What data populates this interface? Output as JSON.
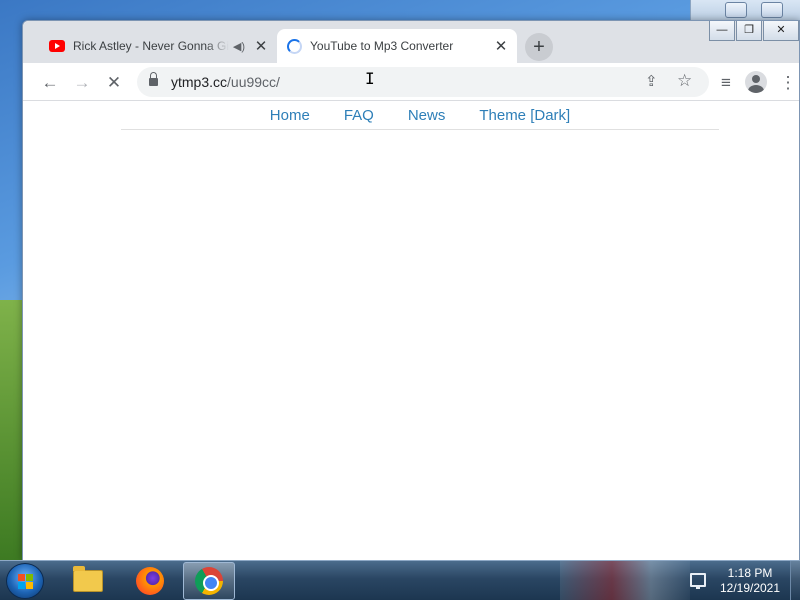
{
  "browser": {
    "tabs": [
      {
        "title": "Rick Astley - Never Gonna Give You Up",
        "favicon": "youtube-icon",
        "audio": "audio-playing-icon",
        "active": false
      },
      {
        "title": "YouTube to Mp3 Converter",
        "favicon": "loading-spinner-icon",
        "active": true
      }
    ],
    "toolbar": {
      "back": "←",
      "forward": "→",
      "stop": "✕",
      "url_host": "ytmp3.cc",
      "url_path": "/uu99cc/",
      "share": "⇪",
      "star": "☆",
      "media": "≡"
    },
    "window_controls": {
      "minimize": "—",
      "maximize": "❐",
      "close": "✕"
    },
    "new_tab": "+",
    "close_glyph": "✕"
  },
  "page": {
    "nav": [
      "Home",
      "FAQ",
      "News",
      "Theme [Dark]"
    ]
  },
  "taskbar": {
    "time": "1:18 PM",
    "date": "12/19/2021",
    "apps": [
      "windows-explorer-icon",
      "firefox-icon",
      "chrome-icon"
    ]
  },
  "colors": {
    "link": "#2e7fb8",
    "tabstrip": "#dee1e6",
    "spinner": "#1a73e8"
  }
}
